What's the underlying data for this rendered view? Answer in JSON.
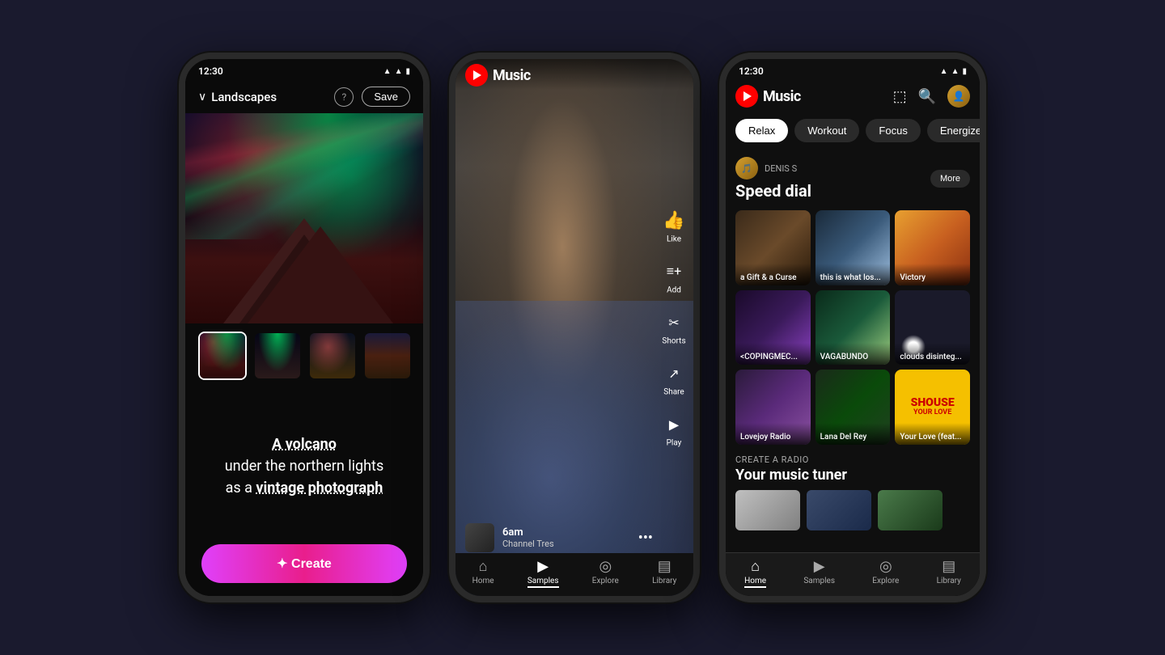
{
  "phone1": {
    "status_time": "12:30",
    "header": {
      "category": "Landscapes",
      "help_label": "?",
      "save_label": "Save"
    },
    "thumbnails": [
      {
        "id": 1,
        "selected": true
      },
      {
        "id": 2
      },
      {
        "id": 3
      },
      {
        "id": 4
      }
    ],
    "prompt": {
      "line1": "A volcano",
      "line2": "under the northern lights",
      "line3": "as a",
      "line4": "vintage photograph"
    },
    "create_button": "✦ Create"
  },
  "phone2": {
    "logo": "Music",
    "song": {
      "title": "6am",
      "artist": "Channel Tres"
    },
    "actions": [
      {
        "icon": "👍",
        "label": "Like"
      },
      {
        "icon": "≡+",
        "label": "Add"
      },
      {
        "icon": "✂",
        "label": "Shorts"
      },
      {
        "icon": "↗",
        "label": "Share"
      },
      {
        "icon": "▶",
        "label": "Play"
      }
    ],
    "nav": [
      {
        "icon": "🏠",
        "label": "Home",
        "active": false
      },
      {
        "icon": "▶",
        "label": "Samples",
        "active": true
      },
      {
        "icon": "🔍",
        "label": "Explore",
        "active": false
      },
      {
        "icon": "📚",
        "label": "Library",
        "active": false
      }
    ]
  },
  "phone3": {
    "status_time": "12:30",
    "logo": "Music",
    "mood_tabs": [
      {
        "label": "Relax",
        "active": true
      },
      {
        "label": "Workout",
        "active": false
      },
      {
        "label": "Focus",
        "active": false
      },
      {
        "label": "Energize",
        "active": false
      }
    ],
    "section_user": "DENIS S",
    "section_title": "Speed dial",
    "more_label": "More",
    "albums": [
      {
        "label": "a Gift & a Curse"
      },
      {
        "label": "this is what los..."
      },
      {
        "label": "Victory"
      },
      {
        "label": "<COPINGMEC..."
      },
      {
        "label": "VAGABUNDO"
      },
      {
        "label": "clouds disinteg..."
      },
      {
        "label": "Lovejoy Radio"
      },
      {
        "label": "Lana Del Rey"
      },
      {
        "label": "Your Love (feat..."
      }
    ],
    "radio": {
      "section_label": "CREATE A RADIO",
      "title": "Your music tuner"
    },
    "nav": [
      {
        "icon": "🏠",
        "label": "Home",
        "active": true
      },
      {
        "icon": "▶",
        "label": "Samples",
        "active": false
      },
      {
        "icon": "🔍",
        "label": "Explore",
        "active": false
      },
      {
        "icon": "📚",
        "label": "Library",
        "active": false
      }
    ]
  }
}
